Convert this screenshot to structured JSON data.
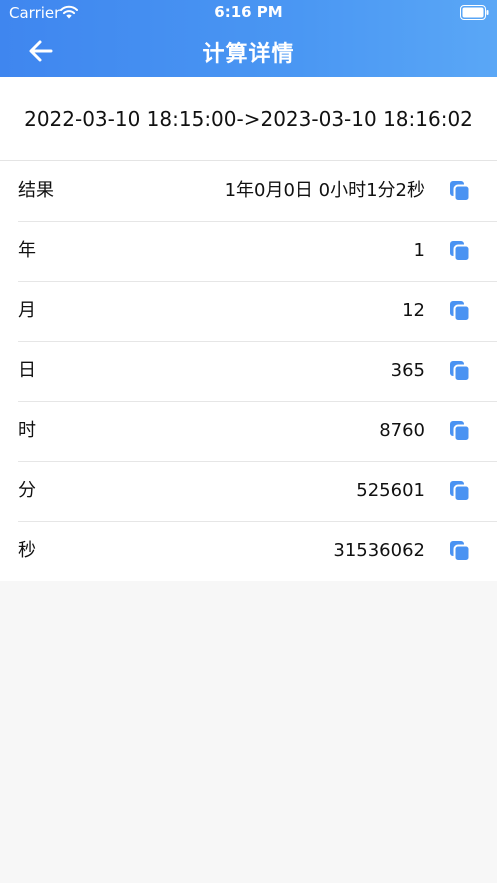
{
  "status": {
    "carrier": "Carrier",
    "time": "6:16 PM"
  },
  "nav": {
    "title": "计算详情"
  },
  "range": "2022-03-10 18:15:00->2023-03-10 18:16:02",
  "rows": [
    {
      "label": "结果",
      "value": "1年0月0日  0小时1分2秒"
    },
    {
      "label": "年",
      "value": "1"
    },
    {
      "label": "月",
      "value": "12"
    },
    {
      "label": "日",
      "value": "365"
    },
    {
      "label": "时",
      "value": "8760"
    },
    {
      "label": "分",
      "value": "525601"
    },
    {
      "label": "秒",
      "value": "31536062"
    }
  ],
  "icons": {
    "back": "arrow-left-icon",
    "copy": "copy-icon"
  },
  "colors": {
    "accent": "#4a93f2",
    "background": "#f7f7f7"
  }
}
